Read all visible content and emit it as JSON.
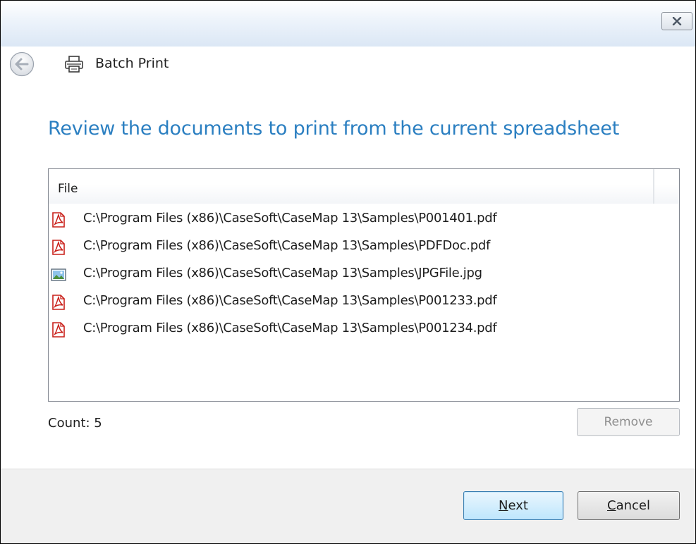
{
  "header": {
    "title": "Batch Print"
  },
  "main": {
    "heading": "Review the documents to print from the current spreadsheet",
    "column_header": "File",
    "files": [
      {
        "path": "C:\\Program Files (x86)\\CaseSoft\\CaseMap 13\\Samples\\P001401.pdf",
        "icon": "pdf-icon"
      },
      {
        "path": "C:\\Program Files (x86)\\CaseSoft\\CaseMap 13\\Samples\\PDFDoc.pdf",
        "icon": "pdf-icon"
      },
      {
        "path": "C:\\Program Files (x86)\\CaseSoft\\CaseMap 13\\Samples\\JPGFile.jpg",
        "icon": "image-file-icon"
      },
      {
        "path": "C:\\Program Files (x86)\\CaseSoft\\CaseMap 13\\Samples\\P001233.pdf",
        "icon": "pdf-icon"
      },
      {
        "path": "C:\\Program Files (x86)\\CaseSoft\\CaseMap 13\\Samples\\P001234.pdf",
        "icon": "pdf-icon"
      }
    ],
    "count_label": "Count: 5",
    "remove_label": "Remove"
  },
  "footer": {
    "next_access_key": "N",
    "next_rest": "ext",
    "cancel_access_key": "C",
    "cancel_rest": "ancel"
  },
  "colors": {
    "heading": "#2b7fc1",
    "pdf_icon": "#c9201a",
    "footer_bg": "#f0f0f0"
  }
}
